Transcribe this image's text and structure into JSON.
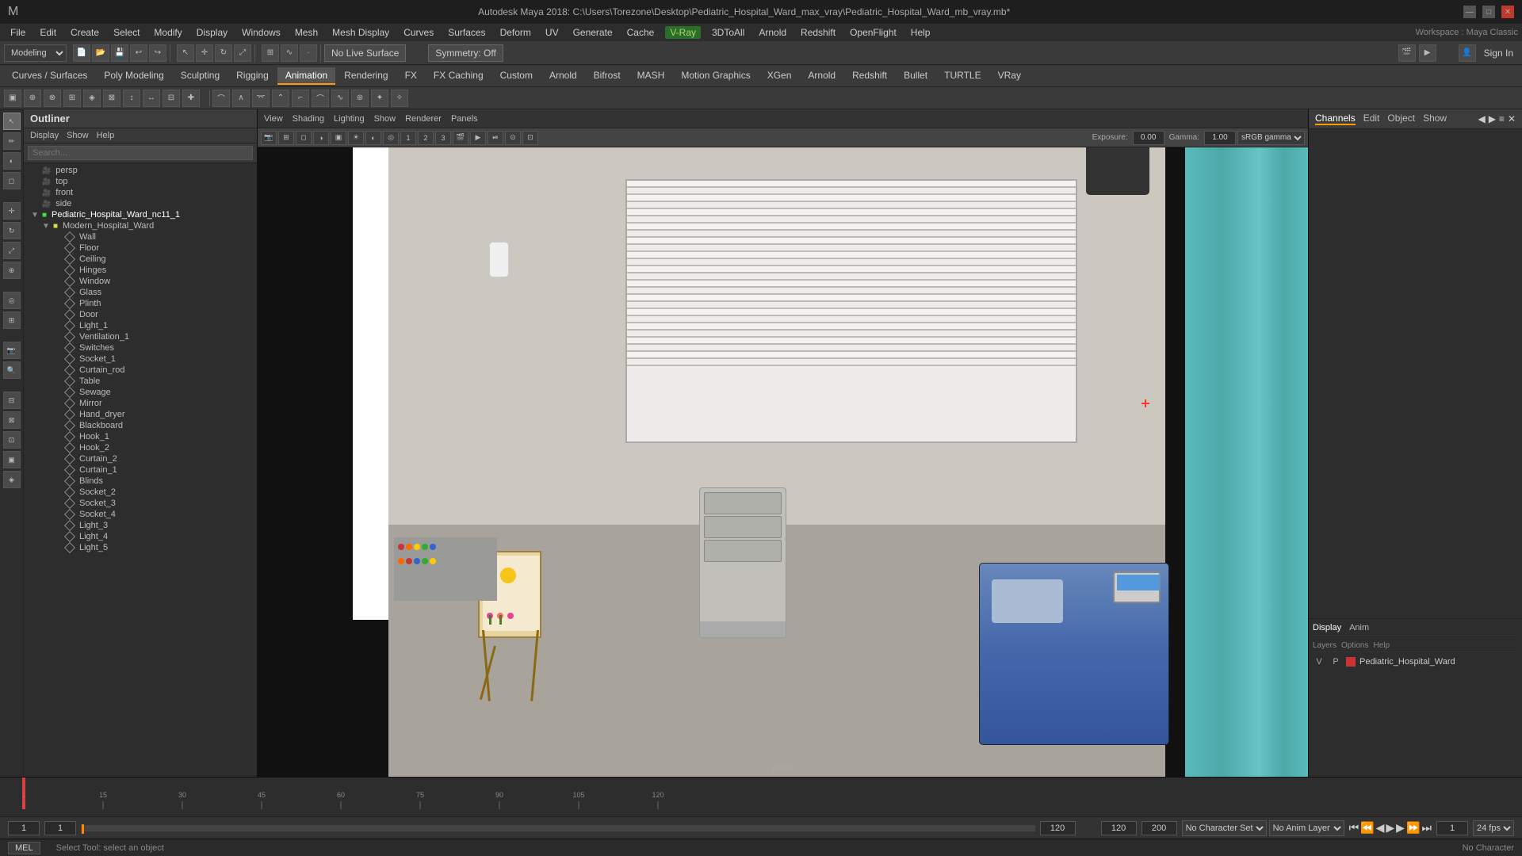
{
  "titlebar": {
    "title": "Autodesk Maya 2018: C:\\Users\\Torezone\\Desktop\\Pediatric_Hospital_Ward_max_vray\\Pediatric_Hospital_Ward_mb_vray.mb*",
    "minimize": "—",
    "maximize": "□",
    "close": "✕"
  },
  "menubar": {
    "items": [
      "File",
      "Edit",
      "Create",
      "Select",
      "Modify",
      "Display",
      "Windows",
      "Mesh",
      "Mesh Display",
      "Curves",
      "Surfaces",
      "Deform",
      "UV",
      "Generate",
      "Cache",
      "V-Ray",
      "3DToAll",
      "Arnold",
      "Redshift",
      "OpenFlight",
      "Help"
    ],
    "workspace": "Workspace : Maya Classic"
  },
  "toolbar1": {
    "mode": "Modeling",
    "no_live_surface": "No Live Surface",
    "symmetry": "Symmetry: Off",
    "sign_in": "Sign In"
  },
  "toolbar2": {
    "tabs": [
      "Curves / Surfaces",
      "Poly Modeling",
      "Sculpting",
      "Rigging",
      "Animation",
      "Rendering",
      "FX",
      "FX Caching",
      "Custom",
      "Arnold",
      "Bifrost",
      "MASH",
      "Motion Graphics",
      "XGen",
      "Arnold",
      "Redshift",
      "Bullet",
      "TURTLE",
      "VRay"
    ]
  },
  "outliner": {
    "title": "Outliner",
    "menu": [
      "Display",
      "Show",
      "Help"
    ],
    "search_placeholder": "Search...",
    "items": [
      {
        "label": "persp",
        "type": "cam",
        "indent": 0
      },
      {
        "label": "top",
        "type": "cam",
        "indent": 0
      },
      {
        "label": "front",
        "type": "cam",
        "indent": 0
      },
      {
        "label": "side",
        "type": "cam",
        "indent": 0
      },
      {
        "label": "Pediatric_Hospital_Ward_nc11_1",
        "type": "folder",
        "indent": 0,
        "expanded": true
      },
      {
        "label": "Modern_Hospital_Ward",
        "type": "folder",
        "indent": 1,
        "expanded": true
      },
      {
        "label": "Wall",
        "type": "mesh",
        "indent": 2
      },
      {
        "label": "Floor",
        "type": "mesh",
        "indent": 2
      },
      {
        "label": "Ceiling",
        "type": "mesh",
        "indent": 2
      },
      {
        "label": "Hinges",
        "type": "mesh",
        "indent": 2
      },
      {
        "label": "Window",
        "type": "mesh",
        "indent": 2
      },
      {
        "label": "Glass",
        "type": "mesh",
        "indent": 2
      },
      {
        "label": "Plinth",
        "type": "mesh",
        "indent": 2
      },
      {
        "label": "Door",
        "type": "mesh",
        "indent": 2
      },
      {
        "label": "Light_1",
        "type": "mesh",
        "indent": 2
      },
      {
        "label": "Ventilation_1",
        "type": "mesh",
        "indent": 2
      },
      {
        "label": "Switches",
        "type": "mesh",
        "indent": 2
      },
      {
        "label": "Socket_1",
        "type": "mesh",
        "indent": 2
      },
      {
        "label": "Curtain_rod",
        "type": "mesh",
        "indent": 2
      },
      {
        "label": "Table",
        "type": "mesh",
        "indent": 2
      },
      {
        "label": "Sewage",
        "type": "mesh",
        "indent": 2
      },
      {
        "label": "Mirror",
        "type": "mesh",
        "indent": 2
      },
      {
        "label": "Hand_dryer",
        "type": "mesh",
        "indent": 2
      },
      {
        "label": "Blackboard",
        "type": "mesh",
        "indent": 2
      },
      {
        "label": "Hook_1",
        "type": "mesh",
        "indent": 2
      },
      {
        "label": "Hook_2",
        "type": "mesh",
        "indent": 2
      },
      {
        "label": "Curtain_2",
        "type": "mesh",
        "indent": 2
      },
      {
        "label": "Curtain_1",
        "type": "mesh",
        "indent": 2
      },
      {
        "label": "Blinds",
        "type": "mesh",
        "indent": 2
      },
      {
        "label": "Socket_2",
        "type": "mesh",
        "indent": 2
      },
      {
        "label": "Socket_3",
        "type": "mesh",
        "indent": 2
      },
      {
        "label": "Socket_4",
        "type": "mesh",
        "indent": 2
      },
      {
        "label": "Light_3",
        "type": "mesh",
        "indent": 2
      },
      {
        "label": "Light_4",
        "type": "mesh",
        "indent": 2
      },
      {
        "label": "Light_5",
        "type": "mesh",
        "indent": 2
      }
    ]
  },
  "viewport": {
    "menu": [
      "View",
      "Shading",
      "Lighting",
      "Show",
      "Renderer",
      "Panels"
    ],
    "persp_label": "persp",
    "gamma_label": "sRGB gamma",
    "exposure": "0.00",
    "gamma_val": "1.00"
  },
  "right_panel": {
    "header_tabs": [
      "Channels",
      "Edit",
      "Object",
      "Show"
    ],
    "layers_tabs": [
      "Display",
      "Anim"
    ],
    "layer_options": [
      "Layers",
      "Options",
      "Help"
    ],
    "layer_v": "V",
    "layer_p": "P",
    "layer_name": "Pediatric_Hospital_Ward",
    "layer_color": "#cc3333"
  },
  "timeline": {
    "start": "1",
    "end": "120",
    "current": "1",
    "range_start": "1",
    "range_end": "120",
    "range_end2": "200",
    "fps": "24 fps"
  },
  "bottom_controls": {
    "frame_start_label": "1",
    "frame_current_label": "1",
    "frame_marker": "1",
    "frame_end": "120",
    "no_character_set": "No Character Set",
    "no_anim_layer": "No Anim Layer",
    "fps": "24 fps"
  },
  "status_bar": {
    "mel_label": "MEL",
    "status_text": "Select Tool: select an object"
  },
  "icons": {
    "move": "↔",
    "rotate": "↻",
    "scale": "⤢",
    "select": "↖",
    "camera": "📷",
    "eye": "👁",
    "gear": "⚙",
    "play": "▶",
    "stop": "■",
    "prev": "◀",
    "next": "▶",
    "expand": "▶",
    "collapse": "▼",
    "folder": "📁",
    "mesh": "◆"
  }
}
